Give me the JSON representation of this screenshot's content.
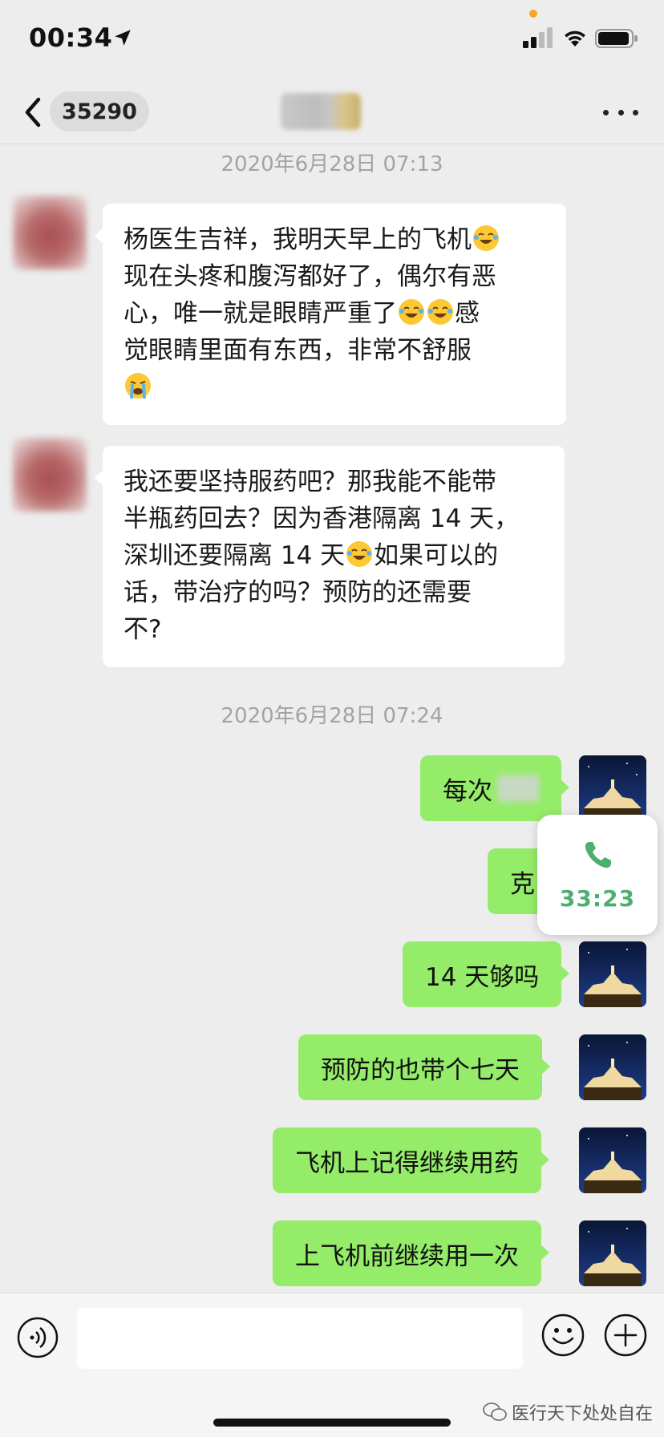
{
  "status_bar": {
    "time": "00:34"
  },
  "nav": {
    "unread_count": "35290"
  },
  "timestamps": [
    "2020年6月28日 07:13",
    "2020年6月28日 07:24"
  ],
  "incoming_messages": [
    {
      "lines": [
        "杨医生吉祥，我明天早上的飞机",
        "现在头疼和腹泻都好了，偶尔有恶",
        "心，唯一就是眼睛严重了",
        "觉眼睛里面有东西，非常不舒服"
      ],
      "line3_suffix": "感"
    },
    {
      "lines": [
        "我还要坚持服药吧？那我能不能带",
        "半瓶药回去？因为香港隔离 14 天，",
        "深圳还要隔离 14 天",
        "话，带治疗的吗？预防的还需要",
        "不?"
      ],
      "line3_suffix": "如果可以的"
    }
  ],
  "outgoing_messages": [
    "每次",
    "克",
    "14 天够吗",
    "预防的也带个七天",
    "飞机上记得继续用药",
    "上飞机前继续用一次"
  ],
  "call": {
    "timer": "33:23"
  },
  "watermark": {
    "text": "医行天下处处自在"
  }
}
